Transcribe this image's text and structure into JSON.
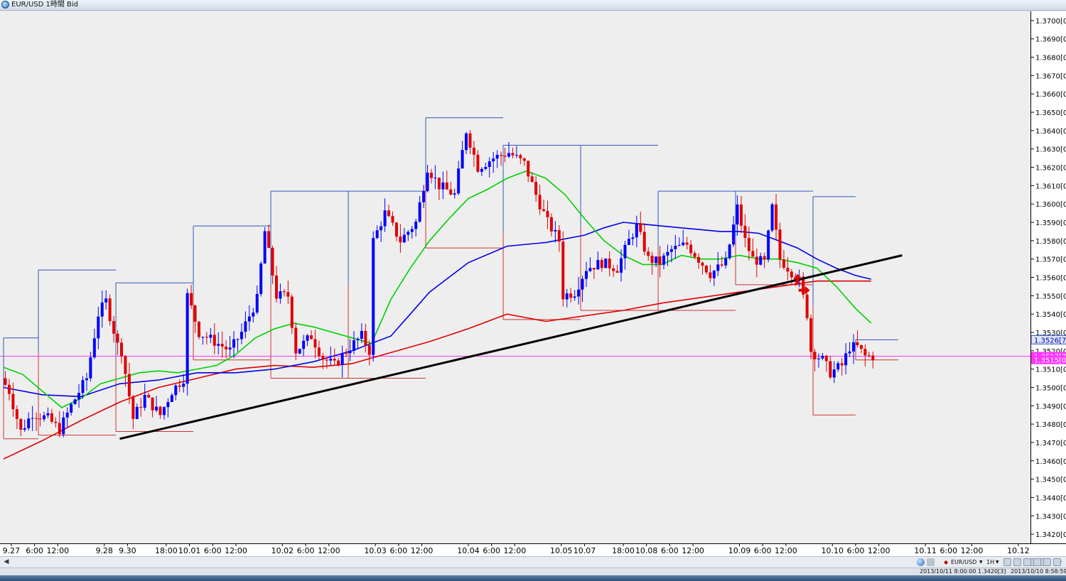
{
  "window": {
    "title": "EUR/USD 1時間 Bid"
  },
  "toolbar": {
    "symbol_label": "EUR/USD",
    "timeframe_label": "1H"
  },
  "status": {
    "cursor_info": "2013/10/11 8:00:00   1.3420[3]",
    "server_time": "2013/10/10 8:58:59"
  },
  "colors": {
    "background": "#eeeeee",
    "up_candle": "#0000ff",
    "down_candle": "#e00000",
    "ma_short": "#00d000",
    "ma_medium": "#0000e6",
    "ma_long": "#e00000",
    "trendline": "#000000",
    "bid_line": "#ff33ff",
    "box_high": "#3355bb",
    "box_low": "#cc3333"
  },
  "chart_data": {
    "type": "candlestick",
    "instrument": "EUR/USD",
    "timeframe": "1H",
    "price_axis": {
      "min": 1.3415,
      "max": 1.3705,
      "ticks": [
        "1.3420[0",
        "1.3430[0",
        "1.3440[0",
        "1.3450[0",
        "1.3460[0",
        "1.3470[0",
        "1.3480[0",
        "1.3490[0",
        "1.3500[0",
        "1.3510[0",
        "1.3520[0",
        "1.3530[0",
        "1.3540[0",
        "1.3550[0",
        "1.3560[0",
        "1.3570[0",
        "1.3580[0",
        "1.3590[0",
        "1.3600[0",
        "1.3610[0",
        "1.3620[0",
        "1.3630[0",
        "1.3640[0",
        "1.3650[0",
        "1.3660[0",
        "1.3670[0",
        "1.3680[0",
        "1.3690[0",
        "1.3700[0"
      ],
      "tick_values": [
        1.342,
        1.343,
        1.344,
        1.345,
        1.346,
        1.347,
        1.348,
        1.349,
        1.35,
        1.351,
        1.352,
        1.353,
        1.354,
        1.355,
        1.356,
        1.357,
        1.358,
        1.359,
        1.36,
        1.361,
        1.362,
        1.363,
        1.364,
        1.365,
        1.366,
        1.367,
        1.368,
        1.369,
        1.37
      ]
    },
    "price_tags": [
      {
        "label": "1.3526[7",
        "value": 1.3526,
        "style": "ask"
      },
      {
        "label": "1.3517[7",
        "value": 1.3517,
        "style": "bid"
      },
      {
        "label": "1.3515[0",
        "value": 1.3515,
        "style": "bid"
      }
    ],
    "bid_price": 1.3517,
    "time_axis": {
      "bars_total": 225,
      "labels": [
        {
          "text": "9.27",
          "bar": 2
        },
        {
          "text": "6:00",
          "bar": 8
        },
        {
          "text": "12:00",
          "bar": 14
        },
        {
          "text": "9.28",
          "bar": 26
        },
        {
          "text": "9.30",
          "bar": 32
        },
        {
          "text": "18:00",
          "bar": 42
        },
        {
          "text": "10.01",
          "bar": 48
        },
        {
          "text": "6:00",
          "bar": 54
        },
        {
          "text": "12:00",
          "bar": 60
        },
        {
          "text": "10.02",
          "bar": 72
        },
        {
          "text": "6:00",
          "bar": 78
        },
        {
          "text": "12:00",
          "bar": 84
        },
        {
          "text": "10.03",
          "bar": 96
        },
        {
          "text": "6:00",
          "bar": 102
        },
        {
          "text": "12:00",
          "bar": 108
        },
        {
          "text": "10.04",
          "bar": 120
        },
        {
          "text": "6:00",
          "bar": 126
        },
        {
          "text": "12:00",
          "bar": 132
        },
        {
          "text": "10.05",
          "bar": 144
        },
        {
          "text": "10.07",
          "bar": 150
        },
        {
          "text": "18:00",
          "bar": 160
        },
        {
          "text": "10.08",
          "bar": 166
        },
        {
          "text": "6:00",
          "bar": 172
        },
        {
          "text": "12:00",
          "bar": 178
        },
        {
          "text": "10.09",
          "bar": 190
        },
        {
          "text": "6:00",
          "bar": 196
        },
        {
          "text": "12:00",
          "bar": 202
        },
        {
          "text": "10.10",
          "bar": 214
        },
        {
          "text": "6:00",
          "bar": 220
        },
        {
          "text": "12:00",
          "bar": 226
        },
        {
          "text": "10.11",
          "bar": 238
        },
        {
          "text": "6:00",
          "bar": 244
        },
        {
          "text": "12:00",
          "bar": 250
        },
        {
          "text": "10.12",
          "bar": 262
        }
      ]
    },
    "anchors": [
      {
        "bar": 0,
        "price": 1.3505
      },
      {
        "bar": 2,
        "price": 1.3498
      },
      {
        "bar": 5,
        "price": 1.3476
      },
      {
        "bar": 8,
        "price": 1.3486
      },
      {
        "bar": 12,
        "price": 1.3483
      },
      {
        "bar": 15,
        "price": 1.3477
      },
      {
        "bar": 18,
        "price": 1.349
      },
      {
        "bar": 22,
        "price": 1.3505
      },
      {
        "bar": 25,
        "price": 1.354
      },
      {
        "bar": 27,
        "price": 1.3547
      },
      {
        "bar": 30,
        "price": 1.3523
      },
      {
        "bar": 31,
        "price": 1.352
      },
      {
        "bar": 34,
        "price": 1.3483
      },
      {
        "bar": 37,
        "price": 1.3495
      },
      {
        "bar": 41,
        "price": 1.3485
      },
      {
        "bar": 44,
        "price": 1.3498
      },
      {
        "bar": 47,
        "price": 1.3505
      },
      {
        "bar": 48,
        "price": 1.355
      },
      {
        "bar": 51,
        "price": 1.353
      },
      {
        "bar": 55,
        "price": 1.3525
      },
      {
        "bar": 59,
        "price": 1.352
      },
      {
        "bar": 62,
        "price": 1.353
      },
      {
        "bar": 66,
        "price": 1.3548
      },
      {
        "bar": 68,
        "price": 1.3585
      },
      {
        "bar": 71,
        "price": 1.355
      },
      {
        "bar": 74,
        "price": 1.355
      },
      {
        "bar": 76,
        "price": 1.352
      },
      {
        "bar": 80,
        "price": 1.3528
      },
      {
        "bar": 83,
        "price": 1.3516
      },
      {
        "bar": 86,
        "price": 1.3512
      },
      {
        "bar": 89,
        "price": 1.352
      },
      {
        "bar": 93,
        "price": 1.3528
      },
      {
        "bar": 95,
        "price": 1.352
      },
      {
        "bar": 96,
        "price": 1.358
      },
      {
        "bar": 99,
        "price": 1.3595
      },
      {
        "bar": 103,
        "price": 1.358
      },
      {
        "bar": 107,
        "price": 1.359
      },
      {
        "bar": 110,
        "price": 1.362
      },
      {
        "bar": 113,
        "price": 1.361
      },
      {
        "bar": 117,
        "price": 1.3605
      },
      {
        "bar": 120,
        "price": 1.364
      },
      {
        "bar": 123,
        "price": 1.362
      },
      {
        "bar": 127,
        "price": 1.3625
      },
      {
        "bar": 131,
        "price": 1.3628
      },
      {
        "bar": 135,
        "price": 1.3622
      },
      {
        "bar": 138,
        "price": 1.3605
      },
      {
        "bar": 141,
        "price": 1.359
      },
      {
        "bar": 144,
        "price": 1.358
      },
      {
        "bar": 145,
        "price": 1.355
      },
      {
        "bar": 148,
        "price": 1.3552
      },
      {
        "bar": 151,
        "price": 1.3565
      },
      {
        "bar": 155,
        "price": 1.3568
      },
      {
        "bar": 159,
        "price": 1.3565
      },
      {
        "bar": 162,
        "price": 1.358
      },
      {
        "bar": 164,
        "price": 1.3588
      },
      {
        "bar": 167,
        "price": 1.357
      },
      {
        "bar": 170,
        "price": 1.3568
      },
      {
        "bar": 173,
        "price": 1.3575
      },
      {
        "bar": 177,
        "price": 1.3578
      },
      {
        "bar": 180,
        "price": 1.357
      },
      {
        "bar": 183,
        "price": 1.3562
      },
      {
        "bar": 187,
        "price": 1.3568
      },
      {
        "bar": 190,
        "price": 1.3598
      },
      {
        "bar": 192,
        "price": 1.358
      },
      {
        "bar": 194,
        "price": 1.357
      },
      {
        "bar": 197,
        "price": 1.3568
      },
      {
        "bar": 199,
        "price": 1.3598
      },
      {
        "bar": 201,
        "price": 1.357
      },
      {
        "bar": 204,
        "price": 1.3563
      },
      {
        "bar": 206,
        "price": 1.3558
      },
      {
        "bar": 208,
        "price": 1.354
      },
      {
        "bar": 209,
        "price": 1.352
      },
      {
        "bar": 212,
        "price": 1.3515
      },
      {
        "bar": 214,
        "price": 1.3508
      },
      {
        "bar": 217,
        "price": 1.3512
      },
      {
        "bar": 219,
        "price": 1.3522
      },
      {
        "bar": 221,
        "price": 1.3522
      },
      {
        "bar": 223,
        "price": 1.3517
      }
    ],
    "ma_short": [
      {
        "bar": 0,
        "price": 1.3511
      },
      {
        "bar": 5,
        "price": 1.3507
      },
      {
        "bar": 10,
        "price": 1.3498
      },
      {
        "bar": 15,
        "price": 1.3489
      },
      {
        "bar": 20,
        "price": 1.3494
      },
      {
        "bar": 25,
        "price": 1.3502
      },
      {
        "bar": 30,
        "price": 1.3505
      },
      {
        "bar": 35,
        "price": 1.3508
      },
      {
        "bar": 40,
        "price": 1.3509
      },
      {
        "bar": 45,
        "price": 1.3508
      },
      {
        "bar": 50,
        "price": 1.351
      },
      {
        "bar": 55,
        "price": 1.3512
      },
      {
        "bar": 60,
        "price": 1.3518
      },
      {
        "bar": 65,
        "price": 1.3527
      },
      {
        "bar": 70,
        "price": 1.3532
      },
      {
        "bar": 75,
        "price": 1.3535
      },
      {
        "bar": 80,
        "price": 1.3533
      },
      {
        "bar": 85,
        "price": 1.353
      },
      {
        "bar": 90,
        "price": 1.3527
      },
      {
        "bar": 95,
        "price": 1.3524
      },
      {
        "bar": 100,
        "price": 1.3548
      },
      {
        "bar": 105,
        "price": 1.3565
      },
      {
        "bar": 110,
        "price": 1.358
      },
      {
        "bar": 115,
        "price": 1.3592
      },
      {
        "bar": 120,
        "price": 1.3603
      },
      {
        "bar": 125,
        "price": 1.3608
      },
      {
        "bar": 130,
        "price": 1.3614
      },
      {
        "bar": 135,
        "price": 1.3618
      },
      {
        "bar": 140,
        "price": 1.3614
      },
      {
        "bar": 145,
        "price": 1.3605
      },
      {
        "bar": 150,
        "price": 1.3592
      },
      {
        "bar": 155,
        "price": 1.358
      },
      {
        "bar": 160,
        "price": 1.3572
      },
      {
        "bar": 165,
        "price": 1.3567
      },
      {
        "bar": 170,
        "price": 1.3567
      },
      {
        "bar": 175,
        "price": 1.3572
      },
      {
        "bar": 180,
        "price": 1.357
      },
      {
        "bar": 185,
        "price": 1.357
      },
      {
        "bar": 190,
        "price": 1.3572
      },
      {
        "bar": 195,
        "price": 1.357
      },
      {
        "bar": 200,
        "price": 1.357
      },
      {
        "bar": 205,
        "price": 1.3568
      },
      {
        "bar": 210,
        "price": 1.3565
      },
      {
        "bar": 215,
        "price": 1.3555
      },
      {
        "bar": 220,
        "price": 1.3543
      },
      {
        "bar": 224,
        "price": 1.3535
      }
    ],
    "ma_medium": [
      {
        "bar": 0,
        "price": 1.35
      },
      {
        "bar": 10,
        "price": 1.3496
      },
      {
        "bar": 20,
        "price": 1.3495
      },
      {
        "bar": 30,
        "price": 1.3502
      },
      {
        "bar": 40,
        "price": 1.3504
      },
      {
        "bar": 50,
        "price": 1.3508
      },
      {
        "bar": 60,
        "price": 1.3508
      },
      {
        "bar": 70,
        "price": 1.351
      },
      {
        "bar": 80,
        "price": 1.3514
      },
      {
        "bar": 90,
        "price": 1.352
      },
      {
        "bar": 100,
        "price": 1.3528
      },
      {
        "bar": 105,
        "price": 1.354
      },
      {
        "bar": 110,
        "price": 1.3552
      },
      {
        "bar": 120,
        "price": 1.3568
      },
      {
        "bar": 130,
        "price": 1.3577
      },
      {
        "bar": 140,
        "price": 1.3579
      },
      {
        "bar": 150,
        "price": 1.3583
      },
      {
        "bar": 155,
        "price": 1.3587
      },
      {
        "bar": 160,
        "price": 1.359
      },
      {
        "bar": 165,
        "price": 1.3589
      },
      {
        "bar": 170,
        "price": 1.3588
      },
      {
        "bar": 175,
        "price": 1.3587
      },
      {
        "bar": 180,
        "price": 1.3586
      },
      {
        "bar": 185,
        "price": 1.3585
      },
      {
        "bar": 190,
        "price": 1.3585
      },
      {
        "bar": 195,
        "price": 1.3584
      },
      {
        "bar": 200,
        "price": 1.358
      },
      {
        "bar": 205,
        "price": 1.3576
      },
      {
        "bar": 210,
        "price": 1.357
      },
      {
        "bar": 215,
        "price": 1.3565
      },
      {
        "bar": 220,
        "price": 1.3561
      },
      {
        "bar": 224,
        "price": 1.3559
      }
    ],
    "ma_long": [
      {
        "bar": 0,
        "price": 1.3461
      },
      {
        "bar": 10,
        "price": 1.3471
      },
      {
        "bar": 20,
        "price": 1.3482
      },
      {
        "bar": 30,
        "price": 1.3492
      },
      {
        "bar": 40,
        "price": 1.35
      },
      {
        "bar": 50,
        "price": 1.3505
      },
      {
        "bar": 60,
        "price": 1.351
      },
      {
        "bar": 70,
        "price": 1.3512
      },
      {
        "bar": 80,
        "price": 1.3511
      },
      {
        "bar": 90,
        "price": 1.3513
      },
      {
        "bar": 100,
        "price": 1.3519
      },
      {
        "bar": 110,
        "price": 1.3525
      },
      {
        "bar": 120,
        "price": 1.3532
      },
      {
        "bar": 130,
        "price": 1.354
      },
      {
        "bar": 140,
        "price": 1.3536
      },
      {
        "bar": 150,
        "price": 1.3539
      },
      {
        "bar": 160,
        "price": 1.3542
      },
      {
        "bar": 170,
        "price": 1.3546
      },
      {
        "bar": 180,
        "price": 1.3549
      },
      {
        "bar": 190,
        "price": 1.3552
      },
      {
        "bar": 200,
        "price": 1.3555
      },
      {
        "bar": 210,
        "price": 1.3558
      },
      {
        "bar": 220,
        "price": 1.3558
      },
      {
        "bar": 224,
        "price": 1.3558
      }
    ],
    "trendline": {
      "bar1": 30,
      "price1": 1.3472,
      "bar2": 232,
      "price2": 1.3572
    },
    "daily_boxes": [
      {
        "bar_start": 0,
        "bar_end": 9,
        "high": 1.3527,
        "low": 1.3472
      },
      {
        "bar_start": 9,
        "bar_end": 29,
        "high": 1.3564,
        "low": 1.3474
      },
      {
        "bar_start": 29,
        "bar_end": 49,
        "high": 1.3557,
        "low": 1.3476
      },
      {
        "bar_start": 49,
        "bar_end": 69,
        "high": 1.3588,
        "low": 1.3515
      },
      {
        "bar_start": 69,
        "bar_end": 89,
        "high": 1.3607,
        "low": 1.3505
      },
      {
        "bar_start": 89,
        "bar_end": 109,
        "high": 1.3607,
        "low": 1.3505
      },
      {
        "bar_start": 109,
        "bar_end": 129,
        "high": 1.3647,
        "low": 1.3576
      },
      {
        "bar_start": 129,
        "bar_end": 149,
        "high": 1.3632,
        "low": 1.3537
      },
      {
        "bar_start": 149,
        "bar_end": 169,
        "high": 1.3632,
        "low": 1.3542
      },
      {
        "bar_start": 169,
        "bar_end": 189,
        "high": 1.3607,
        "low": 1.3542
      },
      {
        "bar_start": 189,
        "bar_end": 209,
        "high": 1.3607,
        "low": 1.3556
      },
      {
        "bar_start": 209,
        "bar_end": 220,
        "high": 1.3604,
        "low": 1.3485
      },
      {
        "bar_start": 220,
        "bar_end": 231,
        "high": 1.3526,
        "low": 1.3515
      }
    ],
    "arrows": [
      {
        "bar": 206,
        "price": 1.3553,
        "direction": "right",
        "color": "#e00000"
      },
      {
        "bar": 205,
        "price": 1.3558,
        "direction": "up",
        "color": "#e00000"
      }
    ]
  }
}
